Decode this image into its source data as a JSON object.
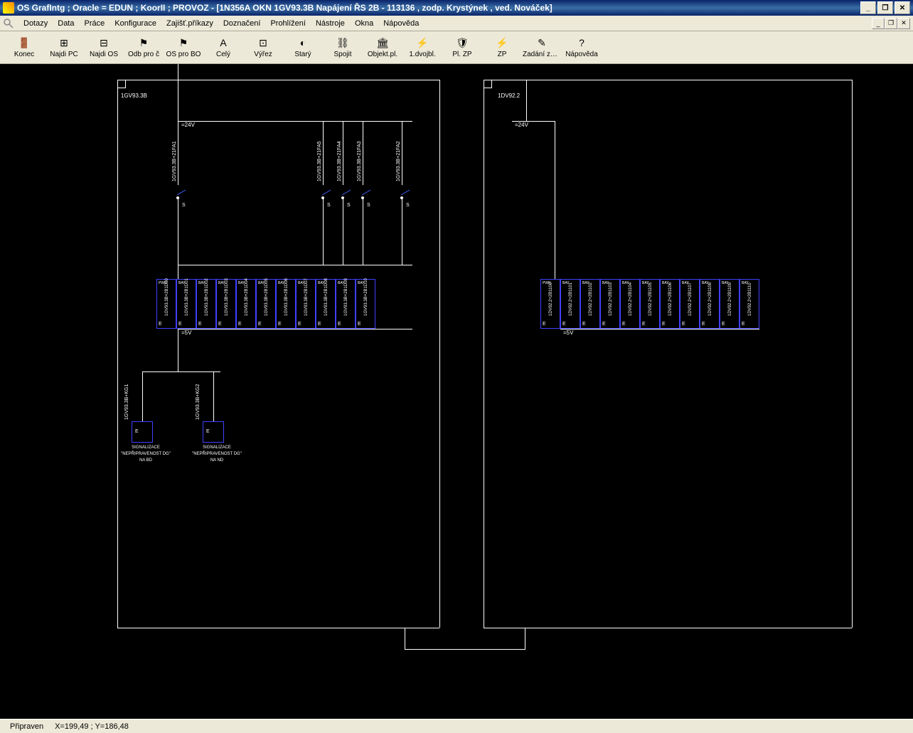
{
  "window": {
    "title": "OS GrafIntg ; Oracle = EDUN ; KoorII ; PROVOZ - [1N356A OKN 1GV93.3B Napájení ŘS 2B - 113136 , zodp. Krystýnek , ved. Nováček]"
  },
  "menu": {
    "items": [
      "Dotazy",
      "Data",
      "Práce",
      "Konfigurace",
      "Zajišť.příkazy",
      "Doznačení",
      "Prohlížení",
      "Nástroje",
      "Okna",
      "Nápověda"
    ]
  },
  "toolbar": {
    "buttons": [
      {
        "label": "Konec",
        "icon": "🚪"
      },
      {
        "label": "Najdi PC",
        "icon": "⊞"
      },
      {
        "label": "Najdi OS",
        "icon": "⊟"
      },
      {
        "label": "Odb pro č",
        "icon": "⚑"
      },
      {
        "label": "OS pro BO",
        "icon": "⚑"
      },
      {
        "label": "Celý",
        "icon": "A"
      },
      {
        "label": "Výřez",
        "icon": "⊡"
      },
      {
        "label": "Starý",
        "icon": "◐"
      },
      {
        "label": "Spojit",
        "icon": "⛓"
      },
      {
        "label": "Objekt.pl.",
        "icon": "🏛"
      },
      {
        "label": "1.dvojbl.",
        "icon": "⚡"
      },
      {
        "label": "Pl. ZP",
        "icon": "🛡"
      },
      {
        "label": "ZP",
        "icon": "⚡"
      },
      {
        "label": "Zadání zm...",
        "icon": "✎"
      },
      {
        "label": "Nápověda",
        "icon": "?"
      }
    ]
  },
  "diagram": {
    "left_panel": {
      "id": "1GV93.3B",
      "voltage_top": "=24V",
      "voltage_bottom": "=5V",
      "switches": [
        "1GV93.3B+21FA1",
        "1GV93.3B+21FA5",
        "1GV93.3B+21FA4",
        "1GV93.3B+21FA3",
        "1GV93.3B+21FA2"
      ],
      "modules": [
        {
          "top": "PWR",
          "id": "1GV93.3B+2B1D00"
        },
        {
          "top": "BAY",
          "id": "1GV93.3B+2B1D01"
        },
        {
          "top": "BAY",
          "id": "1GV93.3B+2B1D02"
        },
        {
          "top": "BAY",
          "id": "1GV93.3B+2B1D03"
        },
        {
          "top": "BAY",
          "id": "1GV93.3B+2B1D04"
        },
        {
          "top": "BAY",
          "id": "1GV93.3B+2B1D05"
        },
        {
          "top": "BAY",
          "id": "1GV93.3B+2B1D06"
        },
        {
          "top": "BAY",
          "id": "1GV93.3B+2B1D07"
        },
        {
          "top": "BAY",
          "id": "1GV93.3B+2B1D08"
        },
        {
          "top": "BAY",
          "id": "1GV93.3B+2B1D09"
        },
        {
          "top": "BAY",
          "id": "1GV93.3B+2B1D10"
        }
      ],
      "signals": [
        {
          "id": "1GV93.3B+KG1",
          "line1": "SIGNALIZACE",
          "line2": "\"NEPŘIPRAVENOST DG\"",
          "line3": "NA BD"
        },
        {
          "id": "1GV93.3B+KG2",
          "line1": "SIGNALIZACE",
          "line2": "\"NEPŘIPRAVENOST DG\"",
          "line3": "NA ND"
        }
      ]
    },
    "right_panel": {
      "id": "1DV92.2",
      "voltage_top": "=24V",
      "voltage_bottom": "=5V",
      "modules": [
        {
          "top": "PWR",
          "id": "1DV92.2+2B1100"
        },
        {
          "top": "BAY",
          "id": "1DV92.2+2B1101"
        },
        {
          "top": "BAY",
          "id": "1DV92.2+2B1102"
        },
        {
          "top": "BAY",
          "id": "1DV92.2+2B1103"
        },
        {
          "top": "BAY",
          "id": "1DV92.2+2B1104"
        },
        {
          "top": "BAY",
          "id": "1DV92.2+2B1105"
        },
        {
          "top": "BAY",
          "id": "1DV92.2+2B1106"
        },
        {
          "top": "BAY",
          "id": "1DV92.2+2B1107"
        },
        {
          "top": "BAY",
          "id": "1DV92.2+2B1108"
        },
        {
          "top": "BAY",
          "id": "1DV92.2+2B1109"
        },
        {
          "top": "BAY",
          "id": "1DV92.2+2B1110"
        }
      ]
    }
  },
  "status": {
    "ready": "Připraven",
    "coords": "X=199,49 ; Y=186,48"
  }
}
